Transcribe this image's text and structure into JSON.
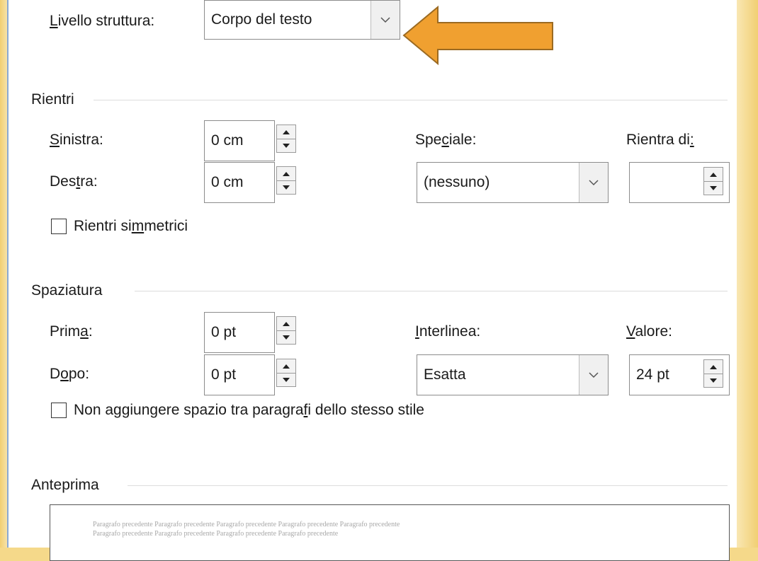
{
  "accent_arrow_color": "#f0a030",
  "outline_level": {
    "label_pre": "",
    "label_ul": "L",
    "label_post": "ivello struttura:",
    "value": "Corpo del testo",
    "dropdown_icon": "chevron-down-icon"
  },
  "indent": {
    "section_title": "Rientri",
    "left": {
      "label_pre": "",
      "label_ul": "S",
      "label_post": "inistra:",
      "value": "0 cm"
    },
    "right": {
      "label_pre": "Des",
      "label_ul": "t",
      "label_post": "ra:",
      "value": "0 cm"
    },
    "special": {
      "label_pre": "Spe",
      "label_ul": "c",
      "label_post": "iale:",
      "value": "(nessuno)"
    },
    "by": {
      "label_pre": "Rientra di",
      "label_ul": ":",
      "label_post": "",
      "value": ""
    },
    "mirror": {
      "label_pre": "Rientri si",
      "label_ul": "m",
      "label_post": "metrici",
      "checked": false
    }
  },
  "spacing": {
    "section_title": "Spaziatura",
    "before": {
      "label_pre": "Prim",
      "label_ul": "a",
      "label_post": ":",
      "value": "0 pt"
    },
    "after": {
      "label_pre": "D",
      "label_ul": "o",
      "label_post": "po:",
      "value": "0 pt"
    },
    "line_spacing": {
      "label_pre": "",
      "label_ul": "I",
      "label_post": "nterlinea:",
      "value": "Esatta"
    },
    "at": {
      "label_pre": "",
      "label_ul": "V",
      "label_post": "alore:",
      "value": "24 pt"
    },
    "dont_add": {
      "label_pre": "Non aggiungere spazio tra paragra",
      "label_ul": "f",
      "label_post": "i dello stesso stile",
      "checked": false
    }
  },
  "preview": {
    "section_title": "Anteprima",
    "line1": "Paragrafo precedente Paragrafo precedente Paragrafo precedente Paragrafo precedente Paragrafo precedente",
    "line2": "Paragrafo precedente Paragrafo precedente Paragrafo precedente Paragrafo precedente"
  }
}
